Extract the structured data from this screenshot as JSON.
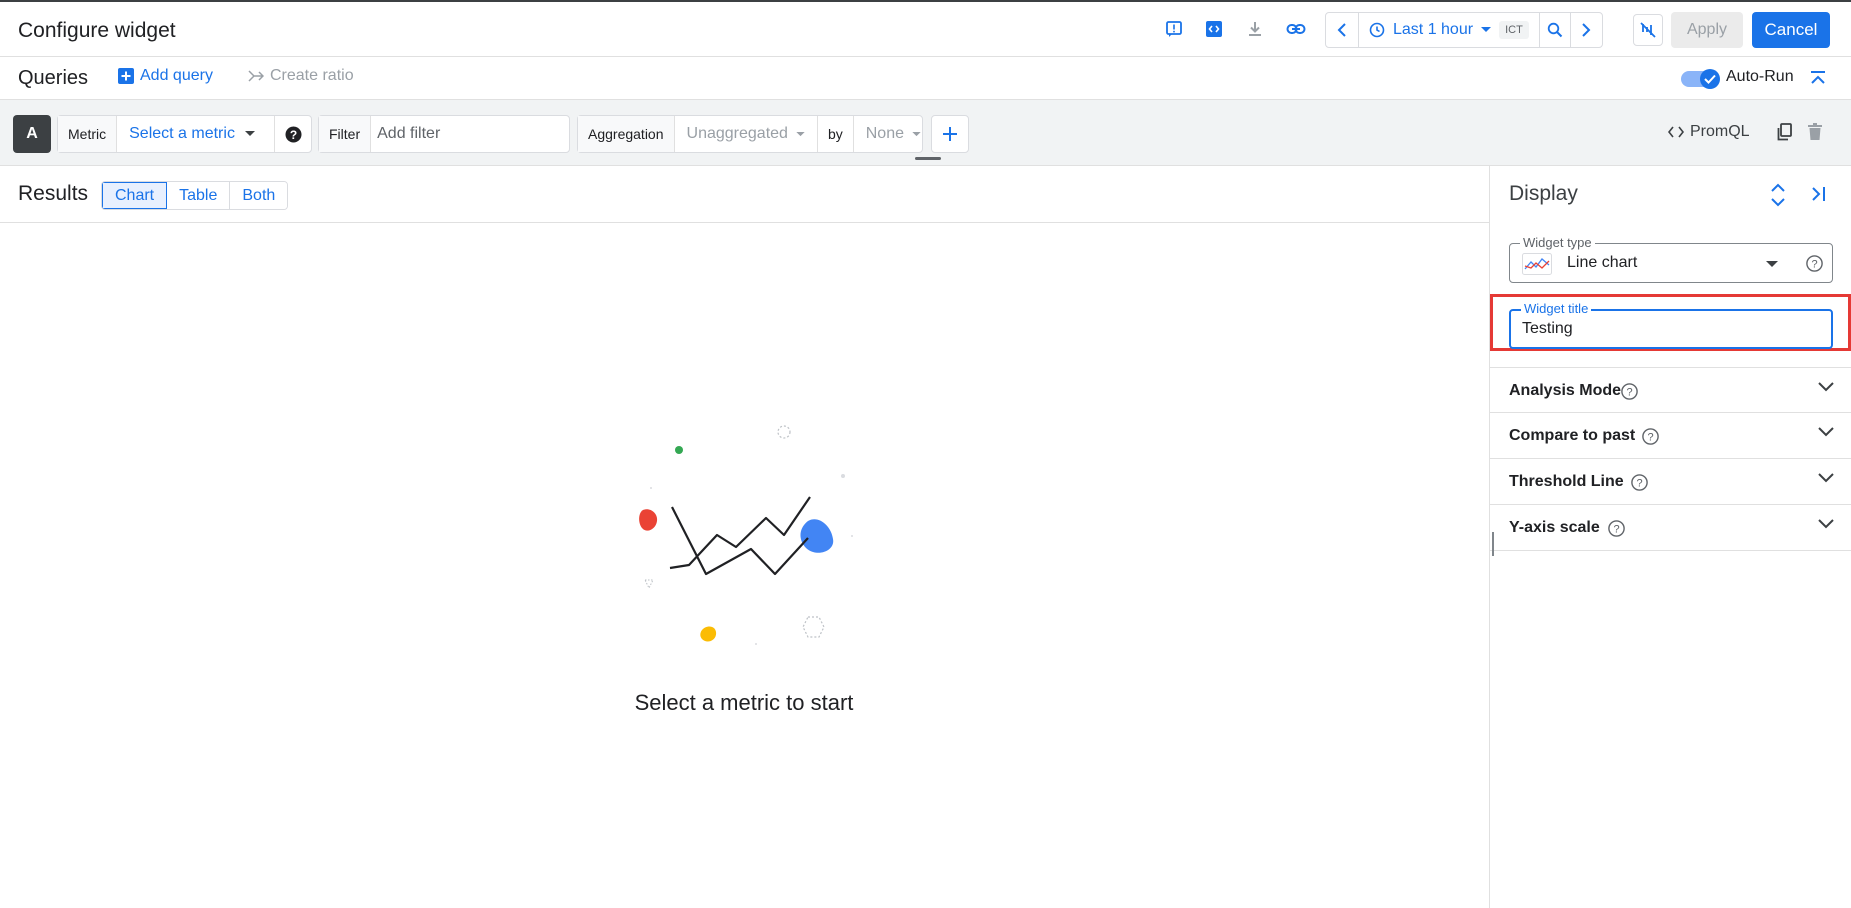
{
  "header": {
    "title": "Configure widget",
    "time_range_label": "Last 1 hour",
    "timezone": "ICT",
    "apply_label": "Apply",
    "cancel_label": "Cancel"
  },
  "queries": {
    "title": "Queries",
    "add_query_label": "Add query",
    "create_ratio_label": "Create ratio",
    "auto_run_label": "Auto-Run",
    "auto_run_enabled": true
  },
  "query_a": {
    "letter": "A",
    "metric_label": "Metric",
    "metric_value": "Select a metric",
    "filter_label": "Filter",
    "filter_placeholder": "Add filter",
    "aggregation_label": "Aggregation",
    "aggregation_value": "Unaggregated",
    "by_label": "by",
    "by_value": "None",
    "promql_label": "PromQL"
  },
  "results": {
    "title": "Results",
    "tabs": [
      "Chart",
      "Table",
      "Both"
    ],
    "active_tab": "Chart",
    "empty_message": "Select a metric to start"
  },
  "display": {
    "title": "Display",
    "widget_type_label": "Widget type",
    "widget_type_value": "Line chart",
    "widget_title_label": "Widget title",
    "widget_title_value": "Testing",
    "sections": [
      "Analysis Mode",
      "Compare to past",
      "Threshold Line",
      "Y-axis scale"
    ]
  },
  "colors": {
    "accent": "#1a73e8",
    "highlight": "#e53935",
    "dot_green": "#34a853",
    "dot_red": "#ea4335",
    "dot_yellow": "#fbbc04",
    "dot_blue": "#4285f4"
  }
}
